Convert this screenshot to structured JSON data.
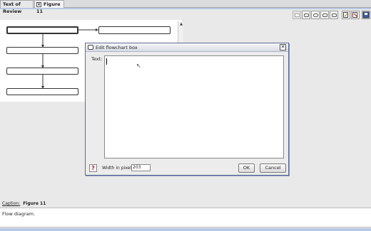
{
  "tabs": [
    {
      "label": "Text of Review"
    },
    {
      "label": "Figure 11"
    }
  ],
  "toolbar": {
    "icons": [
      "rect-icon",
      "rounded-rect-icon",
      "oval-icon",
      "left-arrow-box-icon",
      "right-arrow-box-icon",
      "edit-icon",
      "delete-icon",
      "save-icon"
    ]
  },
  "dialog": {
    "title": "Edit flowchart box",
    "text_label": "Text:",
    "text_value": "",
    "width_label": "Width in pixels:",
    "width_value": "203",
    "ok_label": "OK",
    "cancel_label": "Cancel",
    "help_glyph": "?",
    "close_glyph": "✕"
  },
  "caption": {
    "label": "Caption:",
    "value": "Figure 11",
    "text": "Flow diagram."
  }
}
